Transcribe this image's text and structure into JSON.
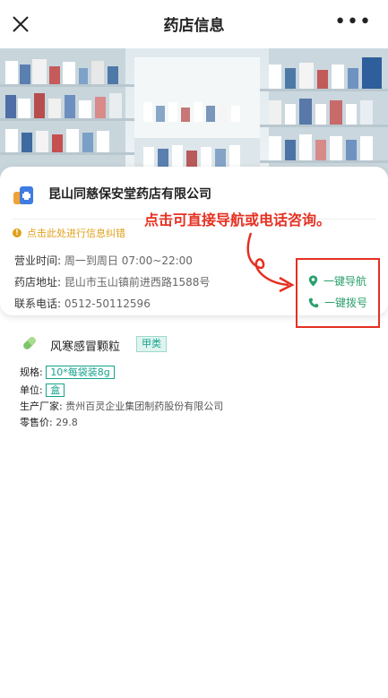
{
  "header": {
    "title": "药店信息",
    "more": "•••"
  },
  "store": {
    "name": "昆山同慈保安堂药店有限公司",
    "correction_link": "点击此处进行信息纠错",
    "hours_label": "营业时间:",
    "hours_value": "周一到周日 07:00~22:00",
    "address_label": "药店地址:",
    "address_value": "昆山市玉山镇前进西路1588号",
    "phone_label": "联系电话:",
    "phone_value": "0512-50112596",
    "navigate_label": "一键导航",
    "call_label": "一键拨号"
  },
  "annotation": {
    "text": "点击可直接导航或电话咨询。",
    "color": "#e53022"
  },
  "drug": {
    "name": "风寒感冒颗粒",
    "tag": "甲类",
    "spec_label": "规格:",
    "spec_value": "10*每袋装8g",
    "unit_label": "单位:",
    "unit_value": "盒",
    "maker_label": "生产厂家:",
    "maker_value": "贵州百灵企业集团制药股份有限公司",
    "price_label": "零售价:",
    "price_value": "29.8"
  },
  "colors": {
    "accent_green": "#2aa06b",
    "warning": "#e0a01a",
    "tag_teal": "#16a38c"
  }
}
